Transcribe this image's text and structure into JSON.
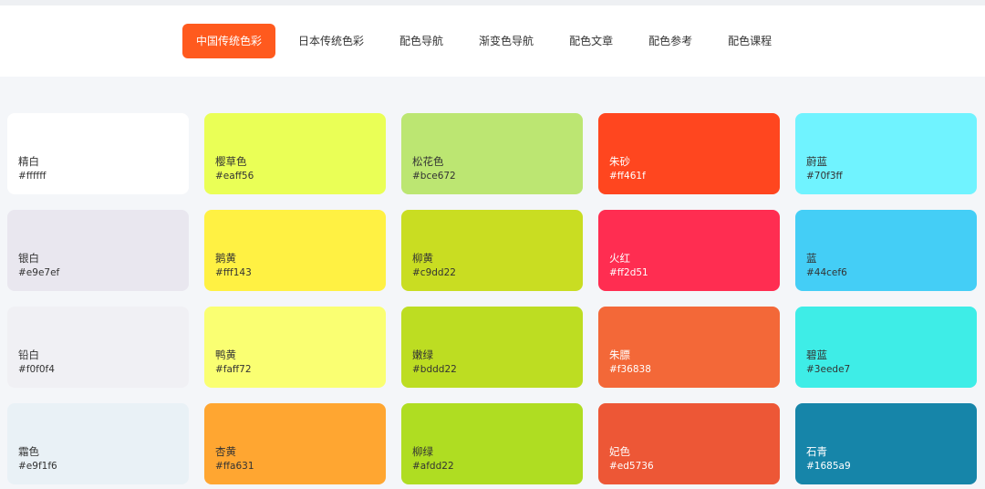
{
  "nav": {
    "items": [
      {
        "label": "中国传统色彩",
        "active": true
      },
      {
        "label": "日本传统色彩",
        "active": false
      },
      {
        "label": "配色导航",
        "active": false
      },
      {
        "label": "渐变色导航",
        "active": false
      },
      {
        "label": "配色文章",
        "active": false
      },
      {
        "label": "配色参考",
        "active": false
      },
      {
        "label": "配色课程",
        "active": false
      }
    ],
    "accent_color": "#ff5a1e"
  },
  "colors": [
    {
      "name": "精白",
      "hex": "#ffffff",
      "text_color": "#333333"
    },
    {
      "name": "樱草色",
      "hex": "#eaff56",
      "text_color": "#333333"
    },
    {
      "name": "松花色",
      "hex": "#bce672",
      "text_color": "#333333"
    },
    {
      "name": "朱砂",
      "hex": "#ff461f",
      "text_color": "#ffffff"
    },
    {
      "name": "蔚蓝",
      "hex": "#70f3ff",
      "text_color": "#333333"
    },
    {
      "name": "银白",
      "hex": "#e9e7ef",
      "text_color": "#333333"
    },
    {
      "name": "鹅黄",
      "hex": "#fff143",
      "text_color": "#333333"
    },
    {
      "name": "柳黄",
      "hex": "#c9dd22",
      "text_color": "#333333"
    },
    {
      "name": "火红",
      "hex": "#ff2d51",
      "text_color": "#ffffff"
    },
    {
      "name": "蓝",
      "hex": "#44cef6",
      "text_color": "#333333"
    },
    {
      "name": "铅白",
      "hex": "#f0f0f4",
      "text_color": "#333333"
    },
    {
      "name": "鸭黄",
      "hex": "#faff72",
      "text_color": "#333333"
    },
    {
      "name": "嫩绿",
      "hex": "#bddd22",
      "text_color": "#333333"
    },
    {
      "name": "朱膘",
      "hex": "#f36838",
      "text_color": "#ffffff"
    },
    {
      "name": "碧蓝",
      "hex": "#3eede7",
      "text_color": "#333333"
    },
    {
      "name": "霜色",
      "hex": "#e9f1f6",
      "text_color": "#333333"
    },
    {
      "name": "杏黄",
      "hex": "#ffa631",
      "text_color": "#333333"
    },
    {
      "name": "柳绿",
      "hex": "#afdd22",
      "text_color": "#333333"
    },
    {
      "name": "妃色",
      "hex": "#ed5736",
      "text_color": "#ffffff"
    },
    {
      "name": "石青",
      "hex": "#1685a9",
      "text_color": "#ffffff"
    }
  ]
}
